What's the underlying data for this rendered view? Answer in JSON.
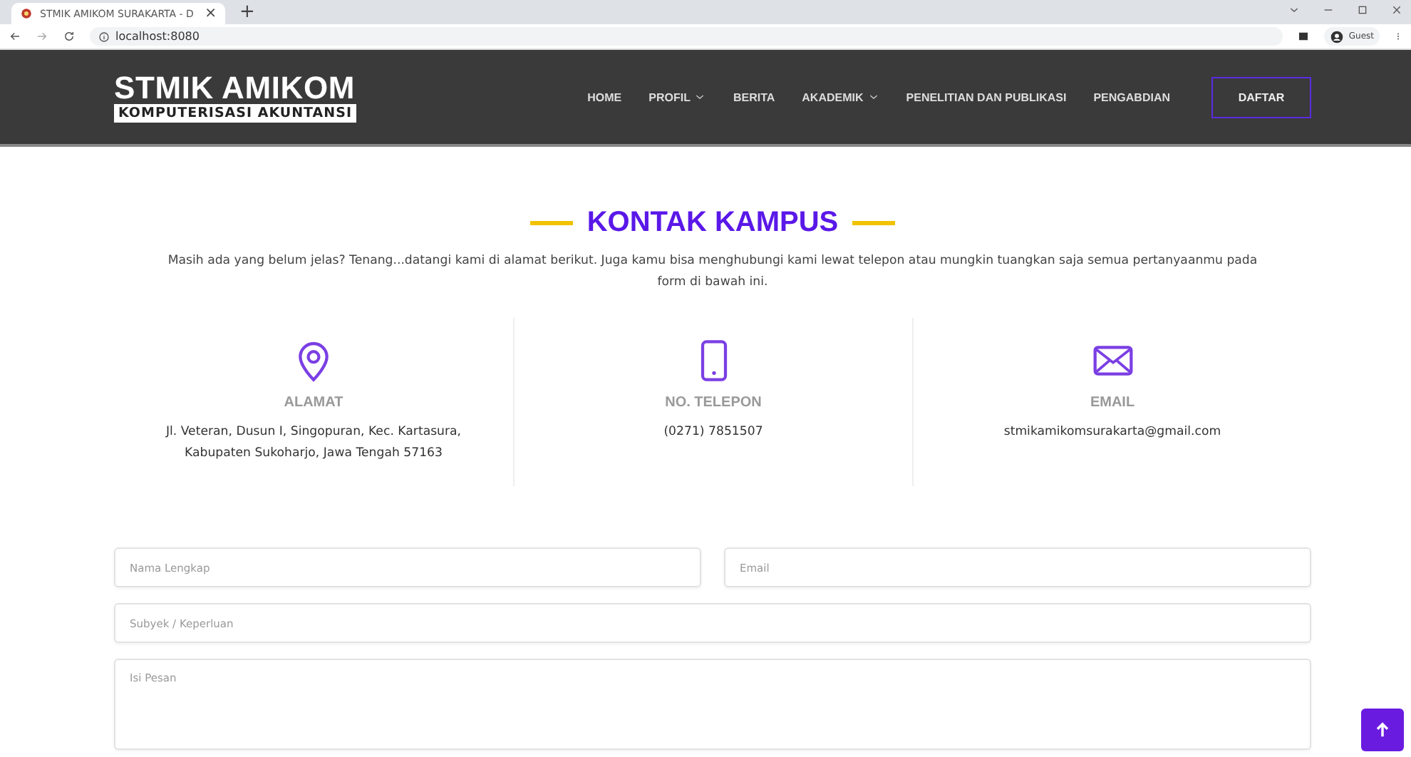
{
  "browser": {
    "tab": {
      "title": "STMIK AMIKOM SURAKARTA - D",
      "close": "×"
    },
    "new_tab": "+",
    "address": "localhost:8080",
    "profile": "Guest"
  },
  "nav": {
    "brand": "STMIK AMIKOM",
    "tagline": "KOMPUTERISASI AKUNTANSI",
    "items": [
      {
        "label": "HOME",
        "dropdown": false
      },
      {
        "label": "PROFIL",
        "dropdown": true
      },
      {
        "label": "BERITA",
        "dropdown": false
      },
      {
        "label": "AKADEMIK",
        "dropdown": true
      },
      {
        "label": "PENELITIAN DAN PUBLIKASI",
        "dropdown": false
      },
      {
        "label": "PENGABDIAN",
        "dropdown": false
      }
    ],
    "cta": "DAFTAR"
  },
  "contact": {
    "title": "KONTAK KAMPUS",
    "intro": "Masih ada yang belum jelas? Tenang...datangi kami di alamat berikut. Juga kamu bisa menghubungi kami lewat telepon atau mungkin tuangkan saja semua pertanyaanmu pada form di bawah ini.",
    "items": [
      {
        "kind": "address",
        "label": "ALAMAT",
        "value": "Jl. Veteran, Dusun I, Singopuran, Kec. Kartasura, Kabupaten Sukoharjo, Jawa Tengah 57163"
      },
      {
        "kind": "phone",
        "label": "NO. TELEPON",
        "value": "(0271) 7851507"
      },
      {
        "kind": "email",
        "label": "EMAIL",
        "value": "stmikamikomsurakarta@gmail.com"
      }
    ],
    "fields": [
      {
        "kind": "input",
        "wide": false,
        "placeholder": "Nama Lengkap"
      },
      {
        "kind": "input",
        "wide": false,
        "placeholder": "Email"
      },
      {
        "kind": "input",
        "wide": true,
        "placeholder": "Subyek / Keperluan"
      },
      {
        "kind": "textarea",
        "wide": true,
        "placeholder": "Isi Pesan"
      }
    ]
  }
}
